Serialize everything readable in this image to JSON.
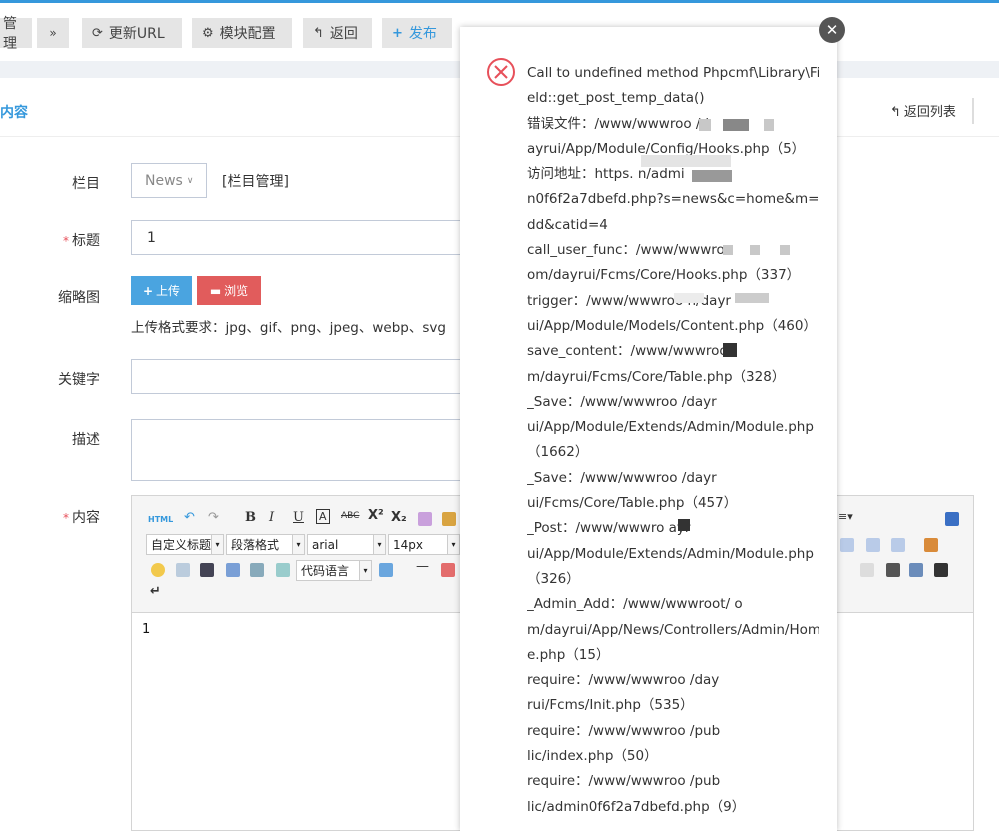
{
  "toolbar": {
    "manage_label": "管理",
    "more_icon": "chevron-double-down-icon",
    "update_url_label": "更新URL",
    "module_config_label": "模块配置",
    "back_label": "返回",
    "publish_label": "发布"
  },
  "panel": {
    "title": "内容",
    "back_list_label": "返回列表"
  },
  "form": {
    "category": {
      "label": "栏目",
      "value": "News",
      "manage_link": "[栏目管理]"
    },
    "title": {
      "label": "标题",
      "value": "1"
    },
    "thumbnail": {
      "label": "缩略图",
      "upload_label": "上传",
      "browse_label": "浏览",
      "format_hint": "上传格式要求：jpg、gif、png、jpeg、webp、svg"
    },
    "keywords": {
      "label": "关键字",
      "value": ""
    },
    "description": {
      "label": "描述",
      "value": ""
    },
    "content": {
      "label": "内容",
      "body": "1",
      "custom_title_select": "自定义标题",
      "paragraph_select": "段落格式",
      "font_select": "arial",
      "size_select": "14px",
      "code_lang_select": "代码语言",
      "html_button": "HTML"
    }
  },
  "error_dialog": {
    "lines": [
      "Call to undefined method Phpcmf\\Library\\Fi",
      "eld::get_post_temp_data()",
      "错误文件：/www/wwwroo          /d",
      "ayrui/App/Module/Config/Hooks.php（5）",
      "访问地址：https.               n/admi",
      "n0f6f2a7dbefd.php?s=news&c=home&m=a",
      "dd&catid=4",
      "call_user_func：/www/wwwroo",
      "om/dayrui/Fcms/Core/Hooks.php（337）",
      "trigger：/www/wwwroo             n/dayr",
      "ui/App/Module/Models/Content.php（460）",
      "save_content：/www/wwwroo",
      "m/dayrui/Fcms/Core/Table.php（328）",
      "_Save：/www/wwwroo              /dayr",
      "ui/App/Module/Extends/Admin/Module.php",
      "（1662）",
      "_Save：/www/wwwroo              /dayr",
      "ui/Fcms/Core/Table.php（457）",
      "_Post：/www/wwwro               ayr",
      "ui/App/Module/Extends/Admin/Module.php",
      "（326）",
      "_Admin_Add：/www/wwwroot/         o",
      "m/dayrui/App/News/Controllers/Admin/Hom",
      "e.php（15）",
      "require：/www/wwwroo              /day",
      "rui/Fcms/Init.php（535）",
      "require：/www/wwwroo              /pub",
      "lic/index.php（50）",
      "require：/www/wwwroo              /pub",
      "lic/admin0f6f2a7dbefd.php（9）"
    ],
    "close_icon": "close-icon",
    "error_icon": "error-circle-x-icon"
  },
  "colors": {
    "accent": "#3598dc",
    "danger": "#e7505a",
    "upload": "#4aa4e0",
    "browse": "#e15c5c"
  }
}
